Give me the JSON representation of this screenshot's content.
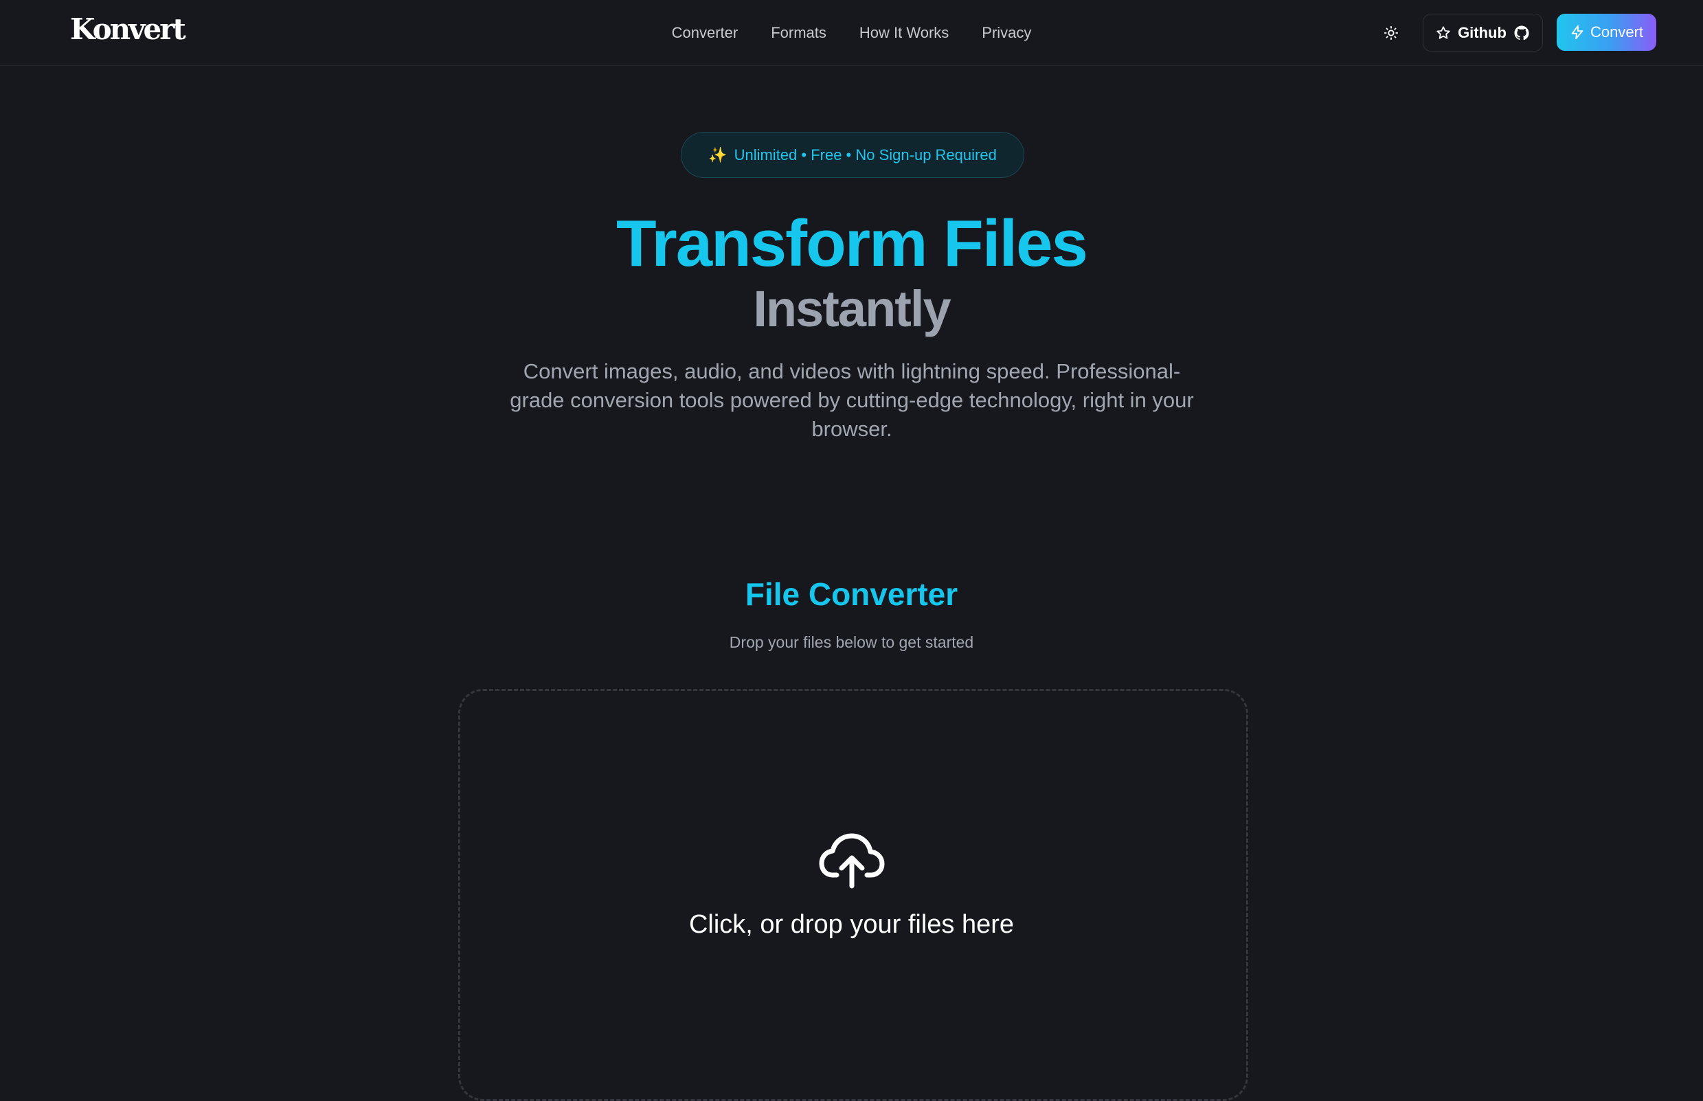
{
  "header": {
    "logo": "Konvert",
    "nav": [
      {
        "label": "Converter"
      },
      {
        "label": "Formats"
      },
      {
        "label": "How It Works"
      },
      {
        "label": "Privacy"
      }
    ],
    "theme_toggle_icon": "sun-icon",
    "github_label": "Github",
    "convert_label": "Convert"
  },
  "hero": {
    "badge": "Unlimited • Free • No Sign-up Required",
    "title": "Transform Files",
    "subtitle": "Instantly",
    "description": "Convert images, audio, and videos with lightning speed. Professional-grade conversion tools powered by cutting-edge technology, right in your browser."
  },
  "converter": {
    "title": "File Converter",
    "subtitle": "Drop your files below to get started",
    "dropzone_text": "Click, or drop your files here"
  },
  "colors": {
    "background": "#17181d",
    "accent": "#17c6ec",
    "muted": "#9ca3af",
    "gradient_start": "#22c5ee",
    "gradient_end": "#8b5cf6"
  }
}
